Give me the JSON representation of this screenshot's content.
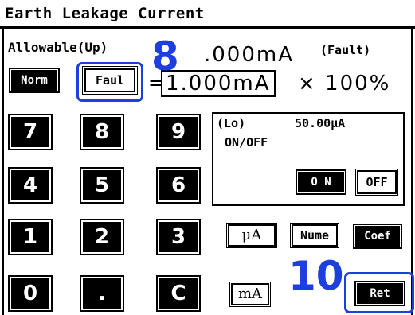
{
  "window": {
    "title": "Earth Leakage Current"
  },
  "allowable": {
    "label": "Allowable(Up)",
    "value": ".000mA",
    "mode": "(Fault)"
  },
  "buttons": {
    "norm": "Norm",
    "faul": "Faul",
    "on": "O N",
    "off": "OFF",
    "micro_a": "μA",
    "nume": "Nume",
    "coef": "Coef",
    "milli_a": "mA",
    "ret": "Ret"
  },
  "formula": {
    "equals": "=",
    "value": "1.000mA",
    "times": "× 100%"
  },
  "keypad": [
    "7",
    "8",
    "9",
    "4",
    "5",
    "6",
    "1",
    "2",
    "3",
    "0",
    ".",
    "C"
  ],
  "lo_panel": {
    "label": "(Lo)",
    "value": "50.00μA",
    "toggle_label": "ON/OFF"
  },
  "annotations": {
    "step_8": "8",
    "step_10": "10"
  },
  "colors": {
    "annotation": "#1e3fe0",
    "key_fill": "#000000",
    "background": "#ffffff"
  }
}
